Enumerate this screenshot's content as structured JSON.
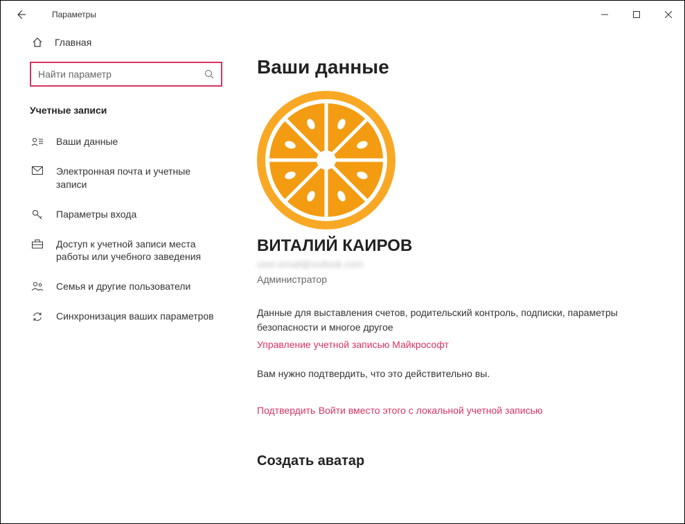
{
  "window": {
    "title": "Параметры"
  },
  "sidebar": {
    "home": "Главная",
    "search_placeholder": "Найти параметр",
    "section": "Учетные записи",
    "items": [
      {
        "label": "Ваши данные"
      },
      {
        "label": "Электронная почта и учетные записи"
      },
      {
        "label": "Параметры входа"
      },
      {
        "label": "Доступ к учетной записи места работы или учебного заведения"
      },
      {
        "label": "Семья и другие пользователи"
      },
      {
        "label": "Синхронизация ваших параметров"
      }
    ]
  },
  "main": {
    "title": "Ваши данные",
    "user_name": "ВИТАЛИЙ КАИРОВ",
    "user_email": "user.email@outlook.com",
    "user_role": "Администратор",
    "billing_text": "Данные для выставления счетов, родительский контроль, подписки, параметры безопасности и многое другое",
    "manage_link": "Управление учетной записью Майкрософт",
    "verify_text": "Вам нужно подтвердить, что это действительно вы.",
    "verify_link": "Подтвердить",
    "local_link": "Войти вместо этого с локальной учетной записью",
    "create_avatar": "Создать аватар"
  },
  "colors": {
    "accent": "#d93362",
    "orange": "#f39c12"
  }
}
